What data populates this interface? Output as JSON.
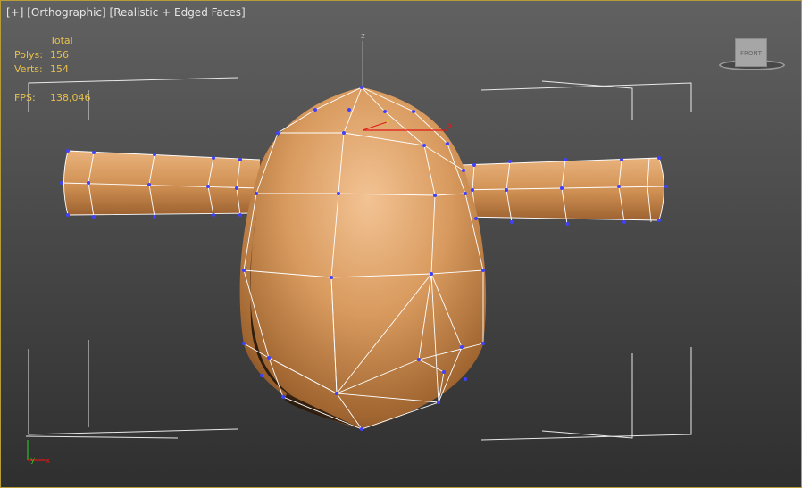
{
  "viewport": {
    "labels": [
      "[+]",
      "[Orthographic]",
      "[Realistic + Edged Faces]"
    ]
  },
  "stats": {
    "header": "Total",
    "polys_label": "Polys:",
    "polys_value": "156",
    "verts_label": "Verts:",
    "verts_value": "154",
    "fps_label": "FPS:",
    "fps_value": "138,046"
  },
  "gizmo": {
    "z": "z",
    "y": "y",
    "x": "x"
  },
  "axis_tripod": {
    "y": "y",
    "x": "x"
  },
  "viewcube": {
    "face_label": "FRONT"
  },
  "colors": {
    "viewport_border": "#b89c38",
    "stats_text": "#e8c14a",
    "mesh_base": "#c98a4f",
    "mesh_highlight": "#f3c394",
    "edges": "#ffffff",
    "vertices": "#4040ff",
    "gizmo_x": "#e01818",
    "gizmo_y": "#2db82d",
    "gizmo_z": "#9a9a9a"
  }
}
